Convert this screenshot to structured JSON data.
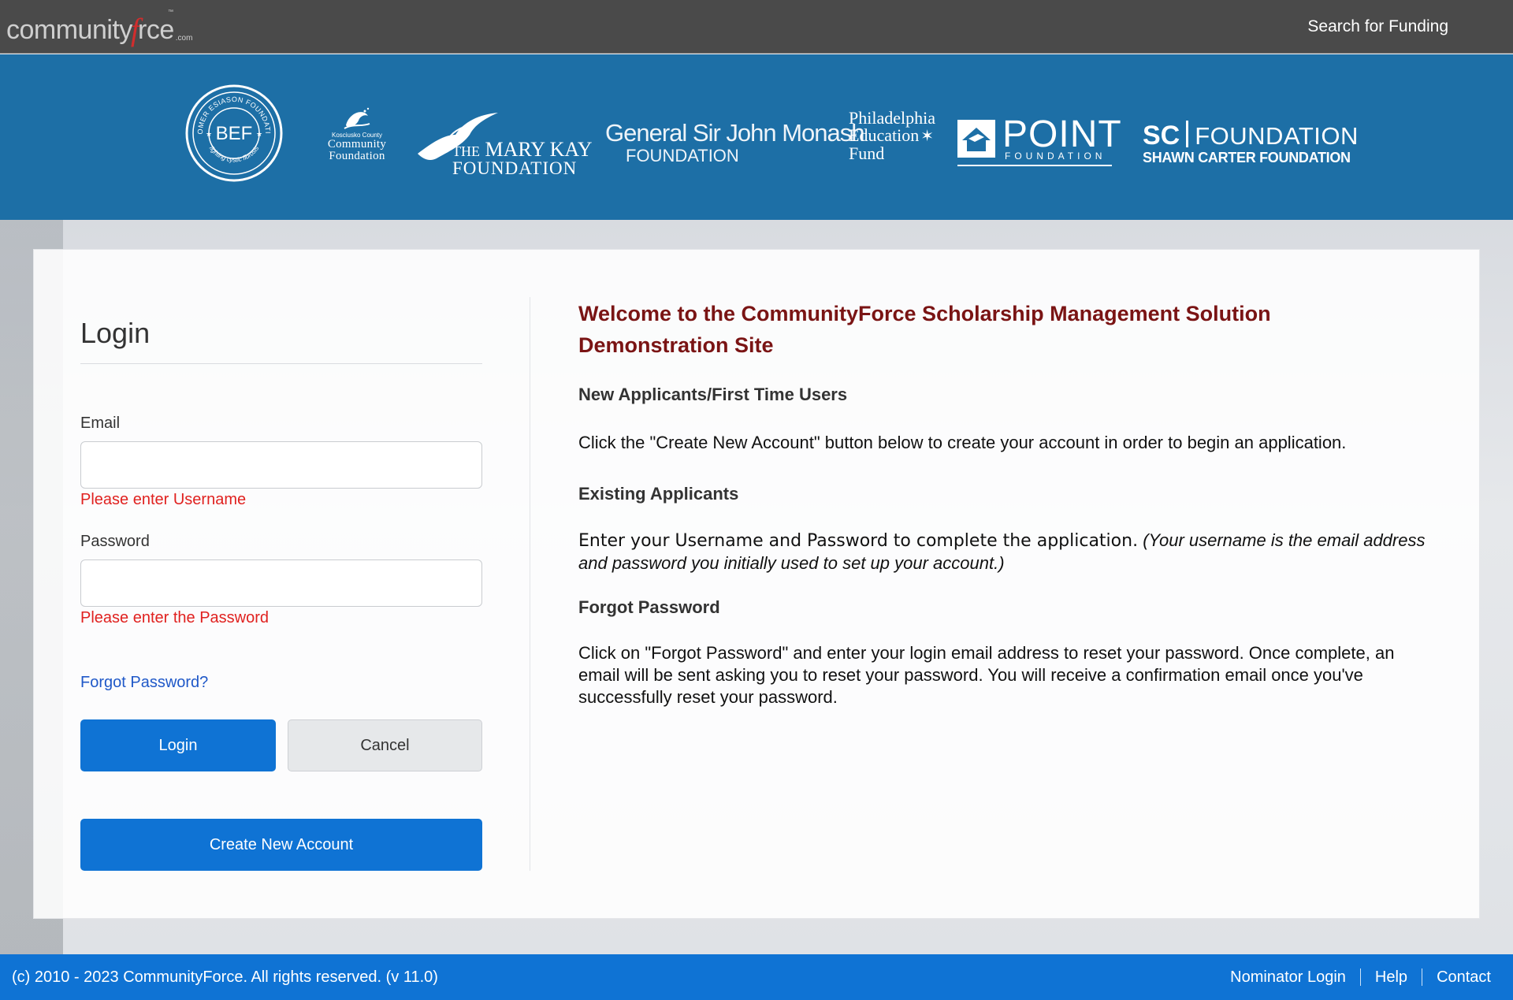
{
  "header": {
    "brand_part1": "community",
    "brand_part2": "f",
    "brand_part3": "rce",
    "brand_suffix": ".com",
    "brand_tm": "™",
    "nav_search_funding": "Search for Funding"
  },
  "sponsors": {
    "bef_top": "BOOMER ESIASON FOUNDATION",
    "bef_center": "BEF",
    "bef_bottom": "fighting cystic fibrosis",
    "kosciusko_small": "Kosciusko County",
    "kosciusko_line1": "Community",
    "kosciusko_line2": "Foundation",
    "marykay_the": "THE",
    "marykay_name": "MARY KAY",
    "marykay_foundation": "FOUNDATION",
    "monash_line1": "General Sir John Monash",
    "monash_line2": "FOUNDATION",
    "phila_line1": "Philadelphia",
    "phila_line2": "Education",
    "phila_line3": "Fund",
    "point_name": "POINT",
    "point_foundation": "FOUNDATION",
    "scf_sc": "SC",
    "scf_foundation": "FOUNDATION",
    "scf_full": "SHAWN CARTER FOUNDATION"
  },
  "login": {
    "title": "Login",
    "email_label": "Email",
    "email_value": "",
    "email_error": "Please enter Username",
    "password_label": "Password",
    "password_value": "",
    "password_error": "Please enter the Password",
    "forgot_link": "Forgot Password?",
    "login_button": "Login",
    "cancel_button": "Cancel",
    "create_button": "Create New Account"
  },
  "info": {
    "welcome_title": "Welcome to the CommunityForce Scholarship Management Solution Demonstration Site",
    "new_heading": "New Applicants/First Time Users",
    "new_text": "Click the \"Create New Account\" button below to create your account in order to begin an application.",
    "existing_heading": "Existing Applicants",
    "existing_text": "Enter your Username and Password to complete the application.",
    "existing_note": "(Your username is the email address and password you initially used to set up your account.)",
    "forgot_heading": "Forgot Password",
    "forgot_text": "Click on \"Forgot Password\"  and enter your login email address to reset your password. Once complete, an email will be sent asking you to reset your password. You will receive a confirmation email once you've successfully reset your password."
  },
  "footer": {
    "copyright": "(c) 2010 - 2023 CommunityForce. All rights reserved. (v 11.0)",
    "links": [
      "Nominator Login",
      "Help",
      "Contact"
    ]
  },
  "colors": {
    "topbar": "#4a4a4a",
    "banner": "#1d6fa6",
    "primary_button": "#0f73d4",
    "error_text": "#e0211f",
    "welcome_title": "#7a1414",
    "link": "#1f58c8"
  },
  "icons": [
    "bef-seal-icon",
    "kosciusko-bird-icon",
    "marykay-bird-icon",
    "phila-star-icon",
    "point-house-icon"
  ]
}
